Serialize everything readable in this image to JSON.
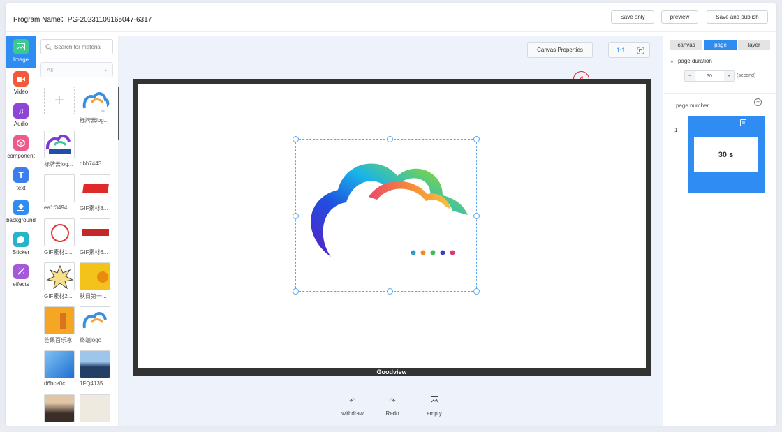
{
  "header": {
    "program_label": "Program Name：PG-20231109165047-6317",
    "save_only": "Save only",
    "preview": "preview",
    "save_publish": "Save and publish"
  },
  "leftnav": {
    "items": [
      {
        "label": "Image",
        "icon": "image-icon",
        "color": "#3cc98f",
        "active": true
      },
      {
        "label": "Video",
        "icon": "video-icon",
        "color": "#f25a3a"
      },
      {
        "label": "Audio",
        "icon": "music-icon",
        "color": "#8e44d6"
      },
      {
        "label": "component",
        "icon": "cube-icon",
        "color": "#ef5a8e"
      },
      {
        "label": "text",
        "icon": "text-icon",
        "color": "#3b7ef0"
      },
      {
        "label": "background",
        "icon": "paint-bucket-icon",
        "color": "#2f8cf3"
      },
      {
        "label": "Sticker",
        "icon": "sticker-icon",
        "color": "#25b4c9"
      },
      {
        "label": "effects",
        "icon": "magic-wand-icon",
        "color": "#a45ad8"
      }
    ]
  },
  "library": {
    "search_placeholder": "Search for materia",
    "filter_value": "All",
    "items": [
      {
        "caption": "",
        "kind": "add"
      },
      {
        "caption": "标牌云log...",
        "kind": "logo"
      },
      {
        "caption": "标牌云log...",
        "kind": "logo-text"
      },
      {
        "caption": "dbb7443...",
        "kind": "blank"
      },
      {
        "caption": "ea1f3494...",
        "kind": "blank"
      },
      {
        "caption": "GIF素材8...",
        "kind": "red-text"
      },
      {
        "caption": "GIF素材1...",
        "kind": "stamp"
      },
      {
        "caption": "GIF素材6...",
        "kind": "red-banner"
      },
      {
        "caption": "GIF素材2...",
        "kind": "burst"
      },
      {
        "caption": "秋日第一...",
        "kind": "yellow"
      },
      {
        "caption": "芒果百乐冰",
        "kind": "orange"
      },
      {
        "caption": "终端logo",
        "kind": "logo"
      },
      {
        "caption": "d6bce0c...",
        "kind": "blue"
      },
      {
        "caption": "1FQ4135...",
        "kind": "sea"
      },
      {
        "caption": "",
        "kind": "photo-dark"
      },
      {
        "caption": "",
        "kind": "photo-light"
      }
    ]
  },
  "workspace": {
    "canvas_properties": "Canvas Properties",
    "marker": "4",
    "screen_label": "Goodview",
    "tools": [
      {
        "label": "withdraw",
        "icon": "undo-icon"
      },
      {
        "label": "Redo",
        "icon": "redo-icon"
      },
      {
        "label": "empty",
        "icon": "clear-canvas-icon"
      }
    ]
  },
  "rightpanel": {
    "tabs": [
      "canvas",
      "page",
      "layer"
    ],
    "active_tab": "page",
    "page_duration_label": "page duration",
    "duration_value": "30",
    "duration_unit": "(second)",
    "minus": "−",
    "plus": "+",
    "page_number_label": "page number",
    "pages": [
      {
        "index": "1",
        "duration": "30 s"
      }
    ]
  },
  "colors": {
    "accent": "#2f8cf3",
    "frame": "#333333"
  }
}
